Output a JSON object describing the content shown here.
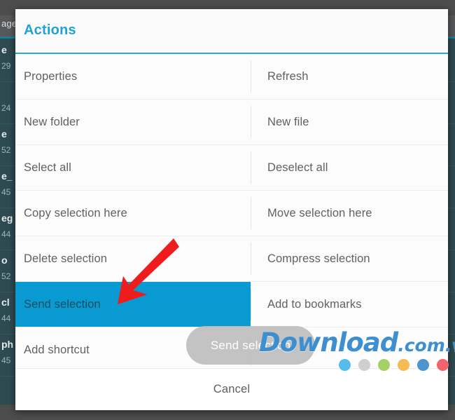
{
  "background": {
    "app_title": "age",
    "files": [
      {
        "name": "e",
        "size": "29"
      },
      {
        "name": "",
        "size": "24"
      },
      {
        "name": "e",
        "size": "52"
      },
      {
        "name": "e_",
        "size": "45"
      },
      {
        "name": "eg",
        "size": "44"
      },
      {
        "name": "o",
        "size": "52"
      },
      {
        "name": "cl",
        "size": "44"
      },
      {
        "name": "ph",
        "size": "45"
      }
    ]
  },
  "dialog": {
    "title": "Actions",
    "rows": [
      {
        "left": "Properties",
        "right": "Refresh"
      },
      {
        "left": "New folder",
        "right": "New file"
      },
      {
        "left": "Select all",
        "right": "Deselect all"
      },
      {
        "left": "Copy selection here",
        "right": "Move selection here"
      },
      {
        "left": "Delete selection",
        "right": "Compress selection"
      },
      {
        "left": "Send selection",
        "right": "Add to bookmarks",
        "selected": true
      },
      {
        "left": "Add shortcut",
        "right": ""
      }
    ],
    "cancel_label": "Cancel"
  },
  "toast": {
    "message": "Send selection"
  },
  "annotation": {
    "arrow_color": "#ee1c1c",
    "points_to": "Send selection"
  },
  "watermark": {
    "brand": "Download",
    "tld": ".com.vn",
    "dots": [
      "#55bdec",
      "#cfcfcf",
      "#a3d165",
      "#f7bb54",
      "#4f95cd",
      "#f2636c"
    ]
  },
  "colors": {
    "accent": "#2aa8da",
    "title": "#1fa2d6",
    "selected_row": "#089ad0",
    "label": "#616161",
    "background": "#2e4a52"
  }
}
